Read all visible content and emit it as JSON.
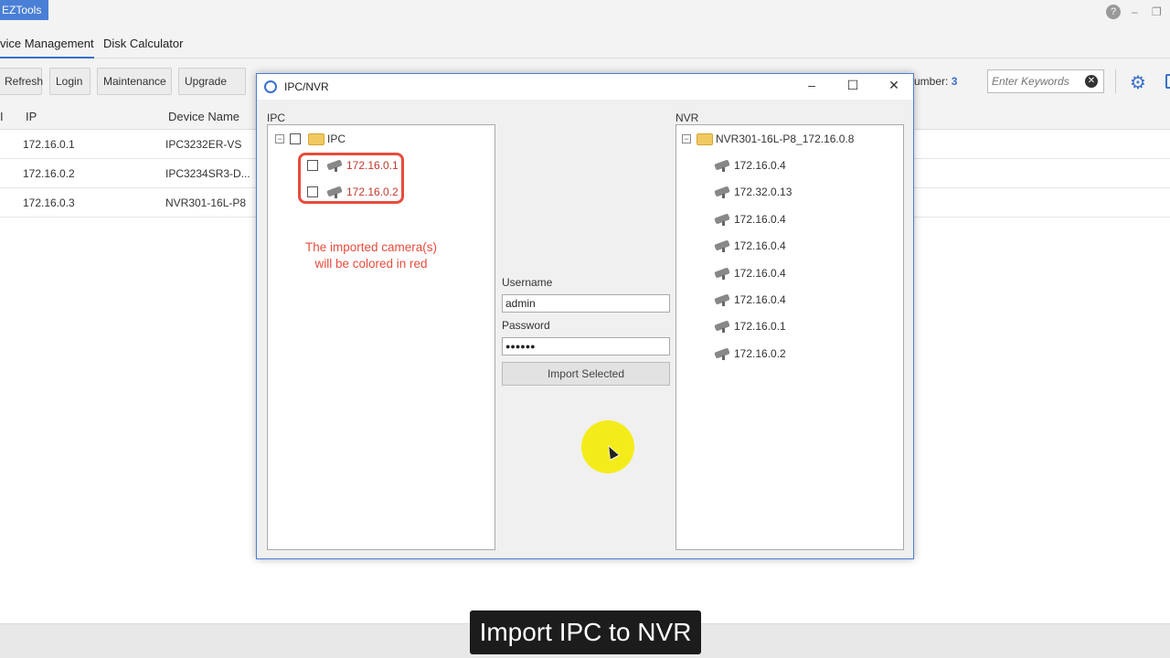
{
  "app": {
    "title": "EZTools",
    "tabs": [
      "vice Management",
      "Disk Calculator"
    ],
    "window_controls": [
      "?",
      "–",
      "❐"
    ]
  },
  "toolbar": {
    "buttons": [
      "Refresh",
      "Login",
      "Maintenance",
      "Upgrade"
    ],
    "number_label": "umber:",
    "number_value": "3",
    "search_placeholder": "Enter Keywords",
    "search_clear": "✕",
    "settings_icon": "⚙"
  },
  "device_table": {
    "headers": [
      "I",
      "IP",
      "Device Name"
    ],
    "rows": [
      {
        "ip": "172.16.0.1",
        "name": "IPC3232ER-VS"
      },
      {
        "ip": "172.16.0.2",
        "name": "IPC3234SR3-D..."
      },
      {
        "ip": "172.16.0.3",
        "name": "NVR301-16L-P8"
      }
    ]
  },
  "dialog": {
    "title": "IPC/NVR",
    "minimize": "–",
    "maximize": "☐",
    "close": "✕",
    "ipc_label": "IPC",
    "nvr_label": "NVR",
    "ipc_tree": {
      "root": "IPC",
      "expander": "−",
      "children": [
        "172.16.0.1",
        "172.16.0.2"
      ]
    },
    "annotation_line1": "The imported camera(s)",
    "annotation_line2": "will be colored in red",
    "username_label": "Username",
    "username_value": "admin",
    "password_label": "Password",
    "password_value": "●●●●●●",
    "import_button": "Import Selected",
    "nvr_tree": {
      "root": "NVR301-16L-P8_172.16.0.8",
      "expander": "−",
      "children": [
        "172.16.0.4",
        "172.32.0.13",
        "172.16.0.4",
        "172.16.0.4",
        "172.16.0.4",
        "172.16.0.4",
        "172.16.0.1",
        "172.16.0.2"
      ]
    },
    "colors": {
      "imported": "#c0392b",
      "highlight": "#e74c3c",
      "accent": "#3a70cc"
    }
  },
  "caption": "Import IPC to NVR"
}
